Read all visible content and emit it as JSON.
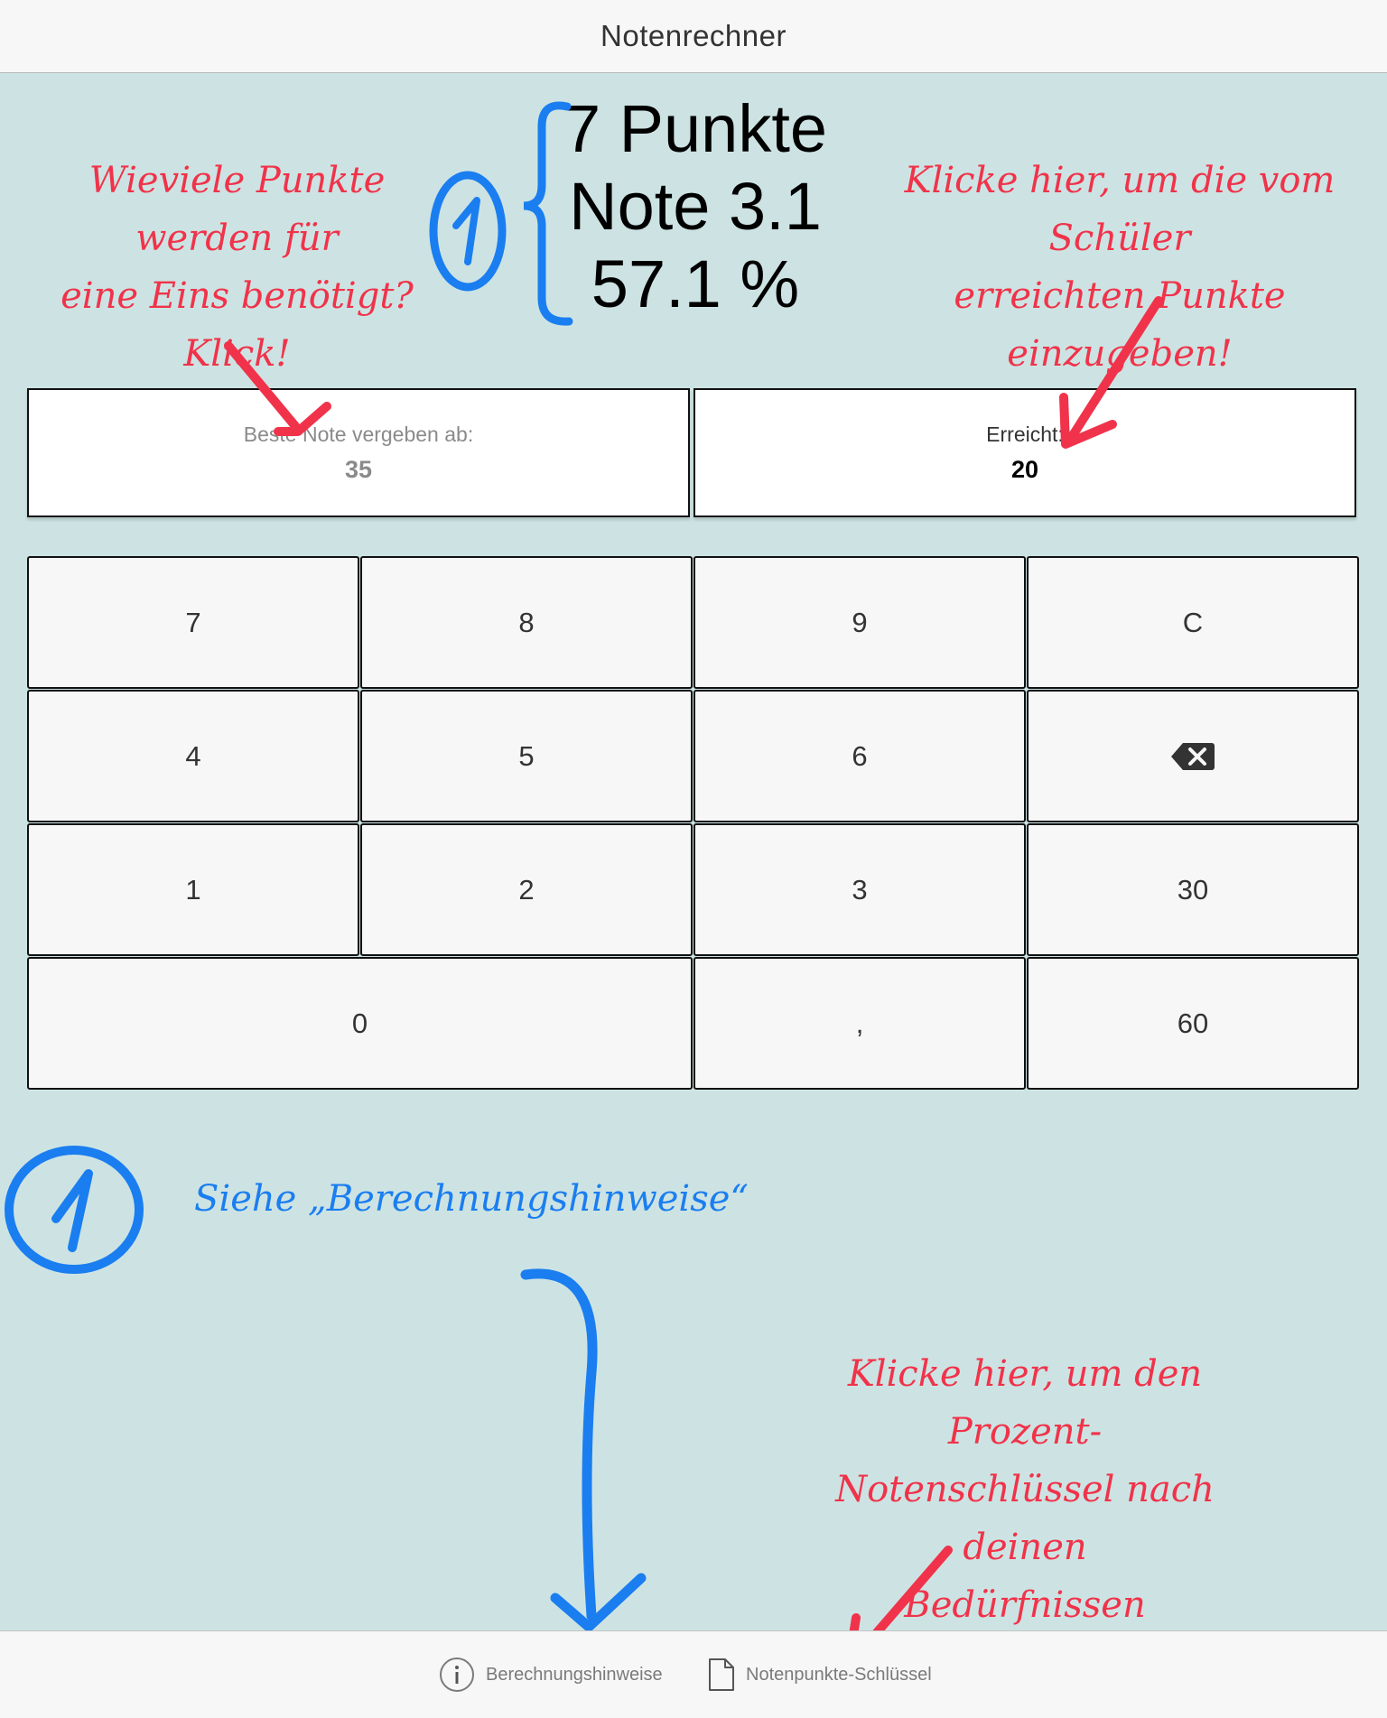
{
  "nav": {
    "title": "Notenrechner"
  },
  "result": {
    "points": "7 Punkte",
    "grade": "Note 3.1",
    "percent": "57.1 %"
  },
  "fields": {
    "best_grade": {
      "label": "Beste Note vergeben ab:",
      "value": "35"
    },
    "achieved": {
      "label": "Erreicht:",
      "value": "20"
    }
  },
  "keypad": {
    "k7": "7",
    "k8": "8",
    "k9": "9",
    "kc": "C",
    "k4": "4",
    "k5": "5",
    "k6": "6",
    "kback_icon": "backspace-icon",
    "k1": "1",
    "k2": "2",
    "k3": "3",
    "k30": "30",
    "k0": "0",
    "kcomma": ",",
    "k60": "60"
  },
  "annotations": {
    "left_question": [
      "Wieviele Punkte werden für",
      "eine Eins benötigt?",
      "Klick!"
    ],
    "right_hint": [
      "Klicke hier, um die vom Schüler",
      "erreichten Punkte einzugeben!"
    ],
    "footnote_marker": "1",
    "footnote_text": "Siehe „Berechnungshinweise“",
    "bottom_hint": [
      "Klicke hier, um den Prozent-",
      "Notenschlüssel nach deinen",
      "Bedürfnissen anzupassen!"
    ]
  },
  "tabs": {
    "info": {
      "label": "Berechnungshinweise",
      "icon": "info-circle-icon"
    },
    "key": {
      "label": "Notenpunkte-Schlüssel",
      "icon": "document-icon"
    }
  },
  "colors": {
    "background": "#cde3e3",
    "annotation_red": "#f0334a",
    "annotation_blue": "#1a7ef0"
  }
}
